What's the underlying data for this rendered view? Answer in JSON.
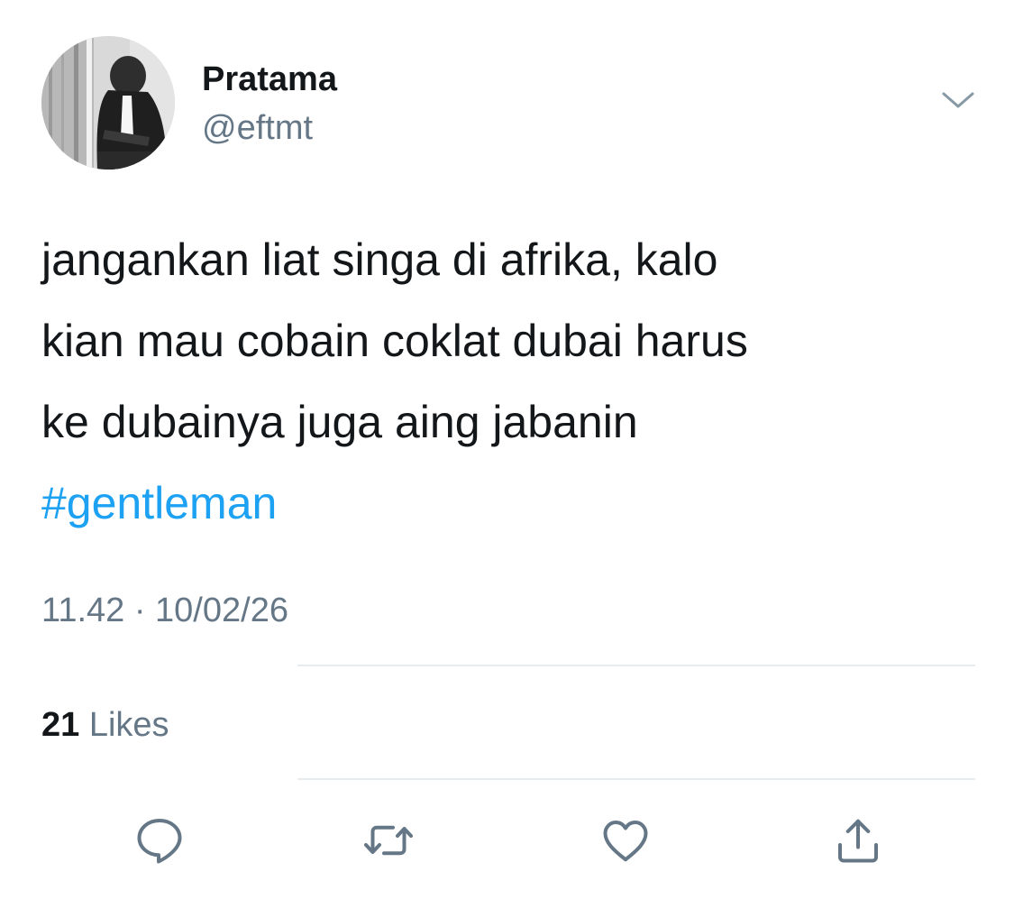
{
  "author": {
    "display_name": "Pratama",
    "handle": "@eftmt"
  },
  "tweet": {
    "lines": [
      "jangankan liat singa di afrika, kalo",
      "kian mau cobain coklat dubai harus",
      "ke dubainya juga aing jabanin"
    ],
    "hashtag": "#gentleman",
    "timestamp": "11.42 · 10/02/26"
  },
  "stats": {
    "likes_count": "21",
    "likes_label": "Likes"
  },
  "icons": {
    "menu": "chevron-down-icon",
    "reply": "reply-icon",
    "retweet": "retweet-icon",
    "like": "heart-icon",
    "share": "share-icon"
  },
  "colors": {
    "text": "#14171a",
    "secondary": "#657786",
    "link": "#1da1f2",
    "divider": "#e6ecf0"
  }
}
